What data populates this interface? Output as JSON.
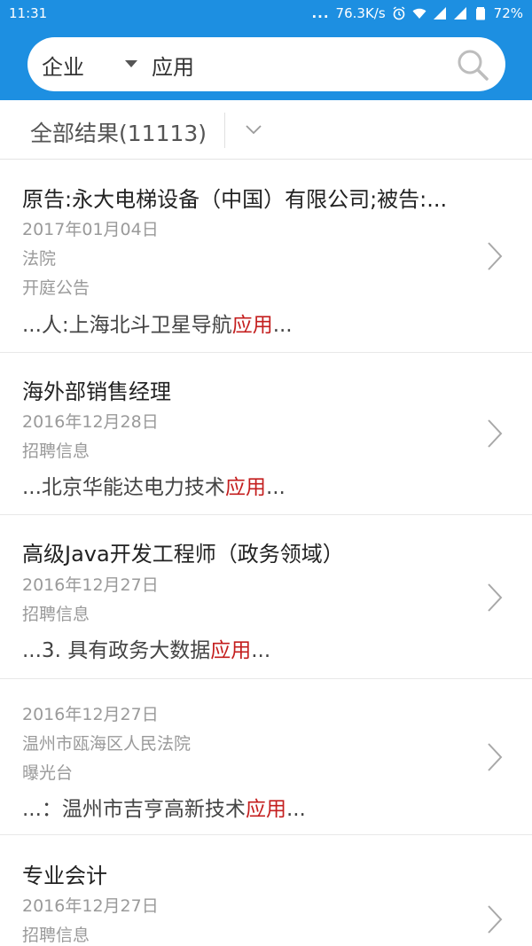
{
  "status_bar": {
    "time": "11:31",
    "dots": "...",
    "net_speed": "76.3K/s",
    "battery": "72%"
  },
  "search": {
    "category": "企业",
    "query": "应用",
    "icon": "search-icon"
  },
  "filter": {
    "label": "全部结果(11113)",
    "icon": "chevron-down-icon"
  },
  "results": [
    {
      "title": "原告:永大电梯设备（中国）有限公司;被告:...",
      "meta": [
        "2017年01月04日",
        "法院",
        "开庭公告"
      ],
      "snippet_pre": "...人:上海北斗卫星导航",
      "snippet_hl": "应用",
      "snippet_post": "..."
    },
    {
      "title": "海外部销售经理",
      "meta": [
        "2016年12月28日",
        "招聘信息"
      ],
      "snippet_pre": "...北京华能达电力技术",
      "snippet_hl": "应用",
      "snippet_post": "..."
    },
    {
      "title": "高级Java开发工程师（政务领域）",
      "meta": [
        "2016年12月27日",
        "招聘信息"
      ],
      "snippet_pre": "...3. 具有政务大数据",
      "snippet_hl": "应用",
      "snippet_post": "..."
    },
    {
      "title": "",
      "meta": [
        "2016年12月27日",
        "温州市瓯海区人民法院",
        "曝光台"
      ],
      "snippet_pre": "...：温州市吉亨高新技术",
      "snippet_hl": "应用",
      "snippet_post": "..."
    },
    {
      "title": "专业会计",
      "meta": [
        "2016年12月27日",
        "招聘信息"
      ],
      "snippet_pre": "",
      "snippet_hl": "",
      "snippet_post": ""
    }
  ],
  "colors": {
    "brand": "#1d8fe1",
    "highlight": "#c41e1e"
  }
}
